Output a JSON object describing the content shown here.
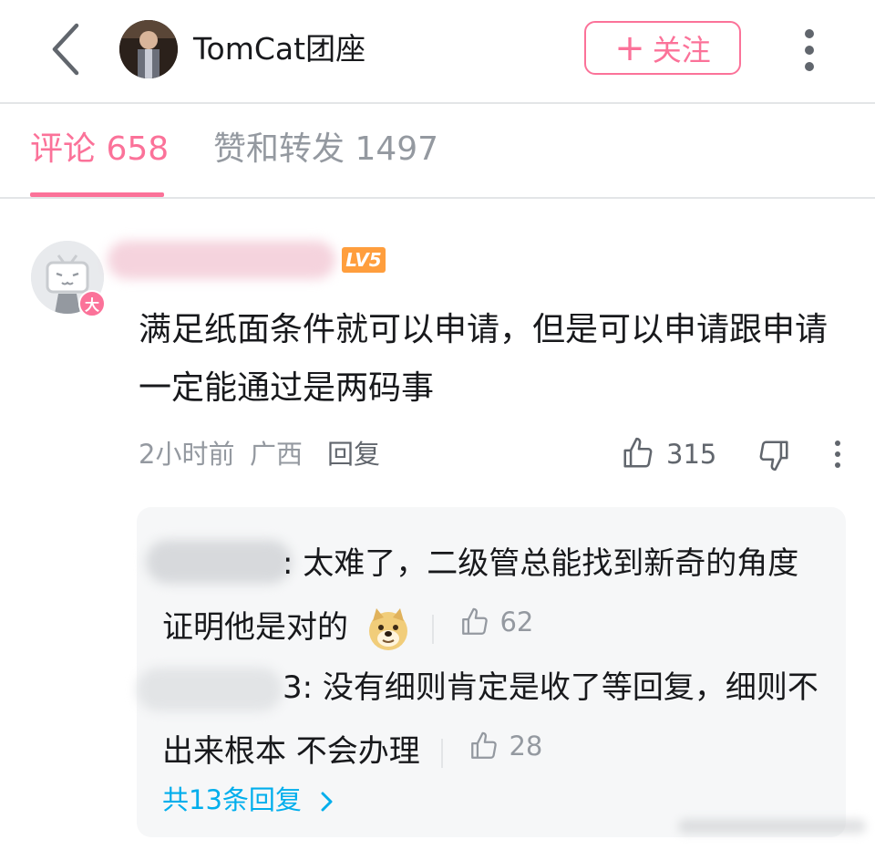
{
  "header": {
    "user_name": "TomCat团座",
    "follow_label": "关注",
    "follow_plus": "+"
  },
  "tabs": [
    {
      "label": "评论 658",
      "active": true
    },
    {
      "label": "赞和转发 1497",
      "active": false
    }
  ],
  "comment": {
    "level": "LV5",
    "avatar_badge": "大",
    "text": "满足纸面条件就可以申请，但是可以申请跟申请一定能通过是两码事",
    "time": "2小时前",
    "location": "广西",
    "reply_label": "回复",
    "likes": "315"
  },
  "replies": [
    {
      "text": ": 太难了，二级管总能找到新奇的角度证明他是对的",
      "likes": "62",
      "emoji": "doge"
    },
    {
      "text": "3: 没有细则肯定是收了等回复，细则不出来根本 不会办理",
      "likes": "28"
    }
  ],
  "total_replies": "共13条回复",
  "colors": {
    "accent": "#fb7299",
    "link": "#00aeec",
    "muted": "#9499a0",
    "level": "#ff9e3d"
  },
  "icons": [
    "back-arrow-icon",
    "more-icon",
    "thumb-up-icon",
    "thumb-down-icon",
    "chevron-right-icon",
    "doge-emoji-icon"
  ]
}
